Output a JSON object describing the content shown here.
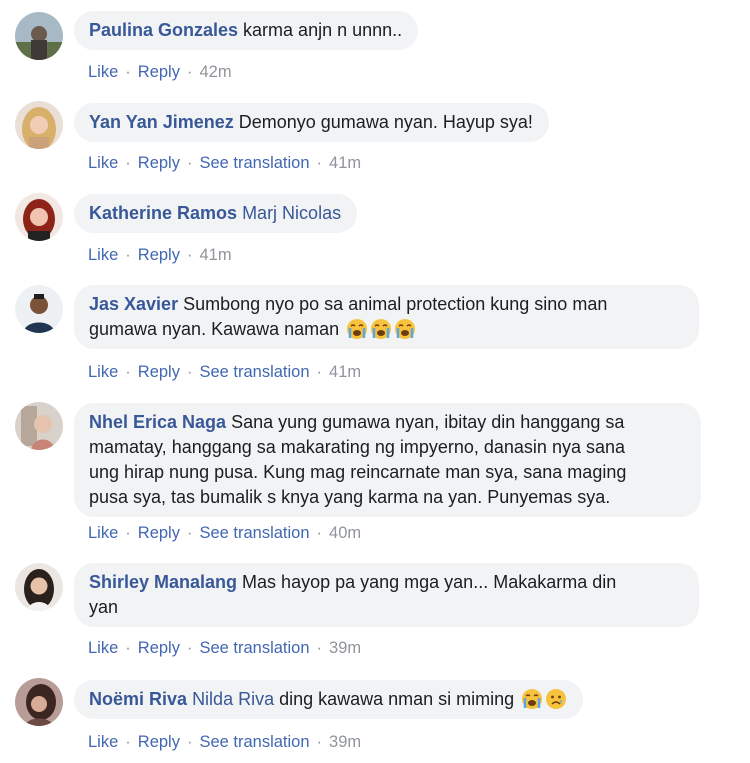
{
  "actions": {
    "like": "Like",
    "reply": "Reply",
    "see_translation": "See translation",
    "sep": "·"
  },
  "comments": [
    {
      "author": "Paulina Gonzales",
      "text": " karma anjn n unnn..",
      "time": "42m"
    },
    {
      "author": "Yan Yan Jimenez",
      "text": " Demonyo gumawa nyan. Hayup sya!",
      "time": "41m"
    },
    {
      "author": "Katherine Ramos",
      "mention": "Marj Nicolas",
      "time": "41m"
    },
    {
      "author": "Jas Xavier",
      "text_line1": " Sumbong nyo po sa animal protection kung sino man",
      "text_line2": "gumawa nyan. Kawawa naman",
      "emojis": [
        "crying-face-icon",
        "crying-face-icon",
        "crying-face-icon"
      ],
      "time": "41m"
    },
    {
      "author": "Nhel Erica Naga",
      "text_line1": " Sana yung gumawa nyan, ibitay din hanggang sa",
      "text_line2": "mamatay, hanggang sa makarating ng impyerno, danasin nya sana",
      "text_line3": "ung hirap nung pusa. Kung mag reincarnate man sya, sana maging",
      "text_line4": "pusa sya, tas bumalik s knya yang karma na yan. Punyemas sya.",
      "time": "40m"
    },
    {
      "author": "Shirley Manalang",
      "text_line1": " Mas hayop pa yang mga yan... Makakarma din",
      "text_line2": "yan",
      "time": "39m"
    },
    {
      "author": "Noëmi Riva",
      "mention": "Nilda Riva",
      "text": " ding kawawa nman si miming",
      "emojis": [
        "crying-face-icon",
        "sad-face-icon"
      ],
      "time": "39m"
    }
  ],
  "colors": {
    "link": "#385898",
    "action": "#4267b2",
    "meta": "#90949c",
    "bubble": "#f2f3f5"
  }
}
